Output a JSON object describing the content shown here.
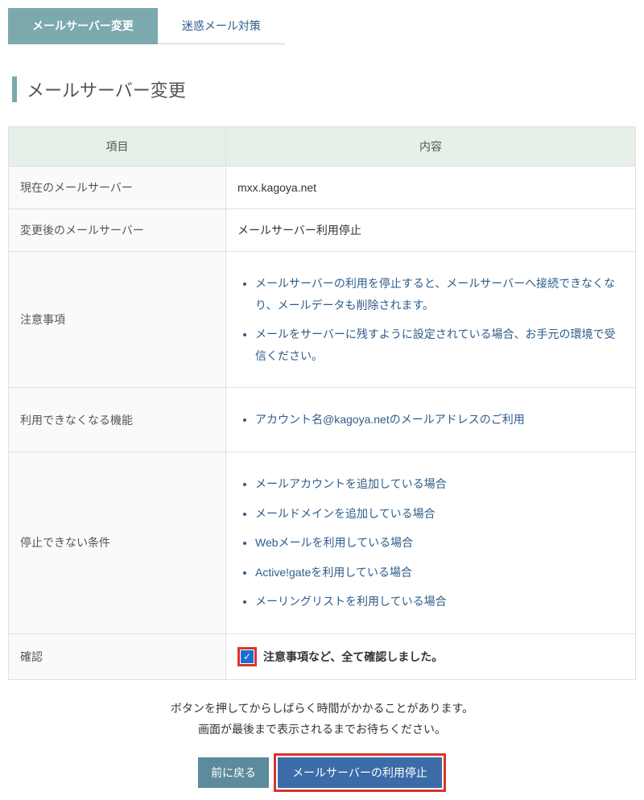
{
  "tabs": {
    "active": "メールサーバー変更",
    "inactive": "迷惑メール対策"
  },
  "page_title": "メールサーバー変更",
  "table": {
    "head_left": "項目",
    "head_right": "内容",
    "rows": {
      "current_server": {
        "label": "現在のメールサーバー",
        "value": "mxx.kagoya.net"
      },
      "after_server": {
        "label": "変更後のメールサーバー",
        "value": "メールサーバー利用停止"
      },
      "notes": {
        "label": "注意事項",
        "items": [
          "メールサーバーの利用を停止すると、メールサーバーへ接続できなくなり、メールデータも削除されます。",
          "メールをサーバーに残すように設定されている場合、お手元の環境で受信ください。"
        ]
      },
      "disabled_features": {
        "label": "利用できなくなる機能",
        "items": [
          "アカウント名@kagoya.netのメールアドレスのご利用"
        ]
      },
      "cannot_stop": {
        "label": "停止できない条件",
        "items": [
          "メールアカウントを追加している場合",
          "メールドメインを追加している場合",
          "Webメールを利用している場合",
          "Active!gateを利用している場合",
          "メーリングリストを利用している場合"
        ]
      },
      "confirm": {
        "label": "確認",
        "checked": true,
        "text": "注意事項など、全て確認しました。"
      }
    }
  },
  "notice": {
    "line1": "ボタンを押してからしばらく時間がかかることがあります。",
    "line2": "画面が最後まで表示されるまでお待ちください。"
  },
  "buttons": {
    "back": "前に戻る",
    "submit": "メールサーバーの利用停止"
  }
}
